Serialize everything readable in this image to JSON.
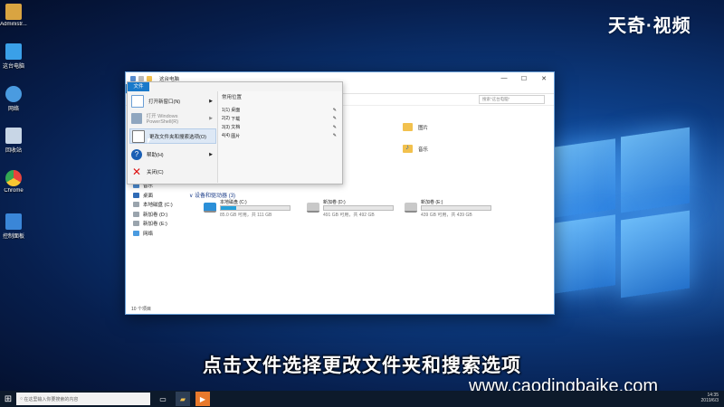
{
  "brand": "天奇·视频",
  "desktop_icons": [
    {
      "label": "Administr...",
      "icon": "user-icon",
      "color": "#d9a441"
    },
    {
      "label": "这台电脑",
      "icon": "computer-icon",
      "color": "#3aa0e8"
    },
    {
      "label": "网络",
      "icon": "network-icon",
      "color": "#4a9be0"
    },
    {
      "label": "回收站",
      "icon": "recycle-bin-icon",
      "color": "#c8d6e6"
    },
    {
      "label": "Chrome",
      "icon": "chrome-icon",
      "color": "#e8453c"
    },
    {
      "label": "控制面板",
      "icon": "control-panel-icon",
      "color": "#3a86d8"
    }
  ],
  "window": {
    "title": "这台电脑",
    "controls": [
      "—",
      "☐",
      "✕"
    ],
    "file_tab": "文件",
    "search_placeholder": "搜索\"这台电脑\"",
    "status": "10 个项目"
  },
  "file_menu": {
    "tab": "文件",
    "items": [
      {
        "label": "打开新窗口(N)",
        "icon": "new-window-icon",
        "arrow": true,
        "dim": false
      },
      {
        "label": "打开 Windows PowerShell(R)",
        "icon": "powershell-icon",
        "arrow": true,
        "dim": true
      },
      {
        "label": "更改文件夹和搜索选项(O)",
        "icon": "folder-options-icon",
        "arrow": false,
        "dim": false,
        "highlighted": true
      },
      {
        "label": "帮助(H)",
        "icon": "help-icon",
        "arrow": true,
        "dim": false
      },
      {
        "label": "关闭(C)",
        "icon": "close-icon",
        "arrow": false,
        "dim": false
      }
    ],
    "frequent_header": "常用位置",
    "frequent": [
      {
        "key": "1(1)",
        "label": "桌面"
      },
      {
        "key": "2(2)",
        "label": "下载"
      },
      {
        "key": "3(3)",
        "label": "文档"
      },
      {
        "key": "4(4)",
        "label": "图片"
      }
    ]
  },
  "quick_folders": [
    {
      "label": "图片",
      "icon": "pictures-folder-icon"
    },
    {
      "label": "音乐",
      "icon": "music-folder-icon"
    }
  ],
  "nav_items": [
    {
      "label": "音乐",
      "icon": "music-icon"
    },
    {
      "label": "桌面",
      "icon": "desktop-icon"
    },
    {
      "label": "本地磁盘 (C:)",
      "icon": "drive-icon"
    },
    {
      "label": "新加卷 (D:)",
      "icon": "drive-icon"
    },
    {
      "label": "新加卷 (E:)",
      "icon": "drive-icon"
    },
    {
      "label": "网络",
      "icon": "network-icon"
    }
  ],
  "drives_header": "∨ 设备和驱动器 (3)",
  "drives": [
    {
      "name": "本地磁盘 (C:)",
      "capacity": "85.0 GB 可用，共 111 GB",
      "used_fraction": 0.23
    },
    {
      "name": "新加卷 (D:)",
      "capacity": "491 GB 可用，共 492 GB",
      "used_fraction": 0.0
    },
    {
      "name": "新加卷 (E:)",
      "capacity": "439 GB 可用，共 439 GB",
      "used_fraction": 0.0
    }
  ],
  "subtitle": "点击文件选择更改文件夹和搜索选项",
  "watermark": "www.caodingbaike.com",
  "taskbar": {
    "search_placeholder": "在这里输入你要搜索的内容",
    "clock_time": "14:35",
    "clock_date": "2019/6/3"
  }
}
